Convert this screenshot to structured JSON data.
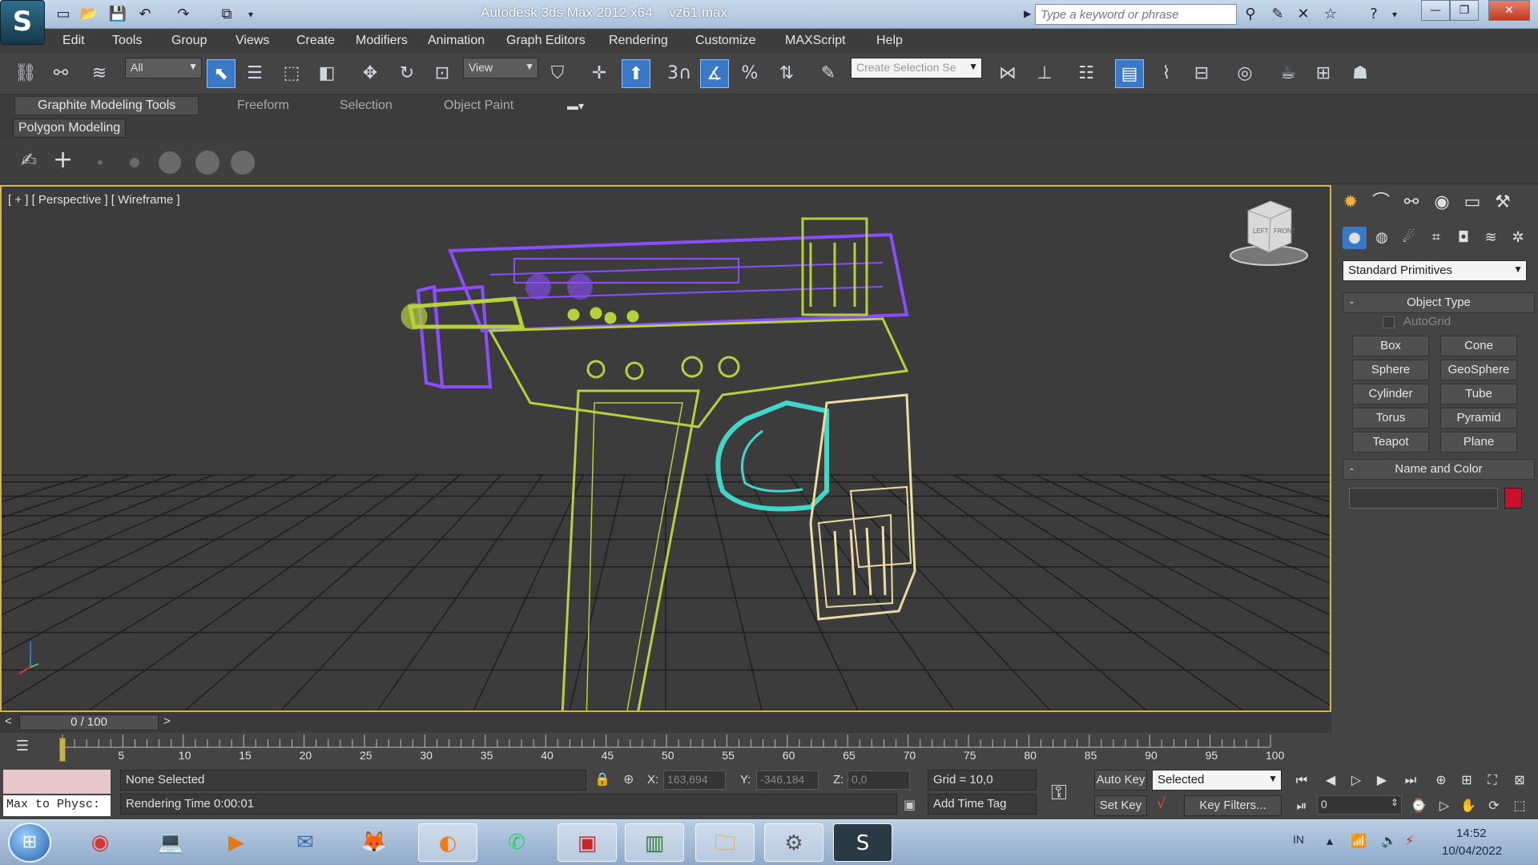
{
  "window": {
    "app_name": "Autodesk 3ds Max 2012 x64",
    "file_name": "vz61.max",
    "search_placeholder": "Type a keyword or phrase",
    "logo_glyph": "S",
    "minimize": "—",
    "maximize": "❐",
    "close": "✕"
  },
  "menu": [
    "Edit",
    "Tools",
    "Group",
    "Views",
    "Create",
    "Modifiers",
    "Animation",
    "Graph Editors",
    "Rendering",
    "Customize",
    "MAXScript",
    "Help"
  ],
  "toolbar": {
    "selection_filter": "All",
    "reference_coord": "View",
    "named_selection_placeholder": "Create Selection Se",
    "snap_label": "3"
  },
  "ribbon": {
    "tabs": [
      "Graphite Modeling Tools",
      "Freeform",
      "Selection",
      "Object Paint"
    ],
    "panel_label": "Polygon Modeling"
  },
  "viewport": {
    "label": "[ + ] [ Perspective ] [ Wireframe ]",
    "viewcube_faces": [
      "LEFT",
      "FRONT"
    ],
    "border_color": "#d8b547",
    "wire_colors": {
      "slide": "#8a4dff",
      "frame": "#b5d13b",
      "trigger": "#3fd7c8",
      "grip": "#ecdca0",
      "grid": "#1e1e1e"
    }
  },
  "command_panel": {
    "category": "Standard Primitives",
    "object_type_title": "Object Type",
    "autogrid_label": "AutoGrid",
    "primitives": [
      "Box",
      "Cone",
      "Sphere",
      "GeoSphere",
      "Cylinder",
      "Tube",
      "Torus",
      "Pyramid",
      "Teapot",
      "Plane"
    ],
    "name_color_title": "Name and Color",
    "object_color": "#c8102e",
    "collapse_symbol": "-"
  },
  "time": {
    "frame_display": "0 / 100",
    "prev": "<",
    "next": ">",
    "ticks": [
      "5",
      "10",
      "15",
      "20",
      "25",
      "30",
      "35",
      "40",
      "45",
      "50",
      "55",
      "60",
      "65",
      "70",
      "75",
      "80",
      "85",
      "90",
      "95",
      "100"
    ]
  },
  "status": {
    "maxscript_listener": "Max to Physc:",
    "selection_status": "None Selected",
    "prompt": "Rendering Time  0:00:01",
    "x_label": "X:",
    "x_value": "163,694",
    "y_label": "Y:",
    "y_value": "-346,184",
    "z_label": "Z:",
    "z_value": "0,0",
    "grid": "Grid = 10,0",
    "add_time_tag": "Add Time Tag",
    "auto_key": "Auto Key",
    "key_mode": "Selected",
    "set_key": "Set Key",
    "key_filters": "Key Filters...",
    "current_frame": "0"
  },
  "taskbar": {
    "apps": [
      "chrome",
      "laptop-app",
      "media-player",
      "mail-app",
      "gimp",
      "firefox",
      "whatsapp",
      "remote-desktop",
      "reader-app",
      "file-explorer",
      "scanner-app",
      "3ds-max"
    ],
    "language": "IN",
    "time": "14:52",
    "date": "10/04/2022"
  }
}
